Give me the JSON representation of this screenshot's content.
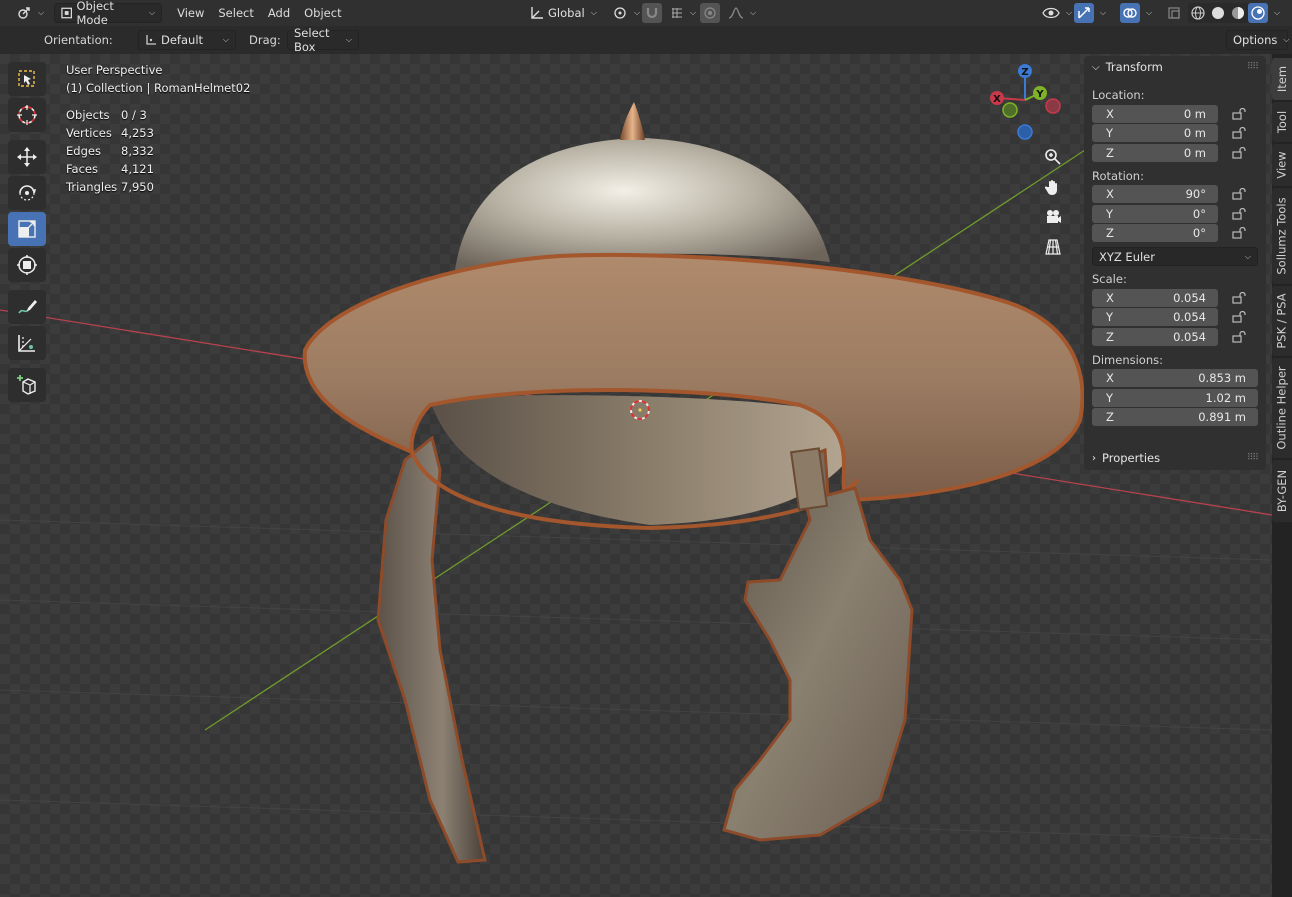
{
  "header": {
    "editor_type_icon": "3d-viewport-icon",
    "mode_label": "Object Mode",
    "menus": [
      "View",
      "Select",
      "Add",
      "Object"
    ],
    "transform_orientation": "Global",
    "options_label": "Options"
  },
  "tool_settings": {
    "orientation_label": "Orientation:",
    "orientation_value": "Default",
    "drag_label": "Drag:",
    "drag_value": "Select Box"
  },
  "viewport": {
    "view_name": "User Perspective",
    "collection_line": "(1) Collection | RomanHelmet02",
    "stats": [
      {
        "label": "Objects",
        "value": "0 / 3"
      },
      {
        "label": "Vertices",
        "value": "4,253"
      },
      {
        "label": "Edges",
        "value": "8,332"
      },
      {
        "label": "Faces",
        "value": "4,121"
      },
      {
        "label": "Triangles",
        "value": "7,950"
      }
    ],
    "gizmo": {
      "x": "X",
      "y": "Y",
      "z": "Z"
    }
  },
  "toolbar": {
    "tools": [
      "select-box-icon",
      "cursor-icon",
      "move-icon",
      "rotate-icon",
      "scale-icon",
      "transform-icon",
      "annotate-icon",
      "measure-icon",
      "add-cube-icon"
    ],
    "active_tool": "scale-icon"
  },
  "npanel": {
    "transform_title": "Transform",
    "location_label": "Location:",
    "location": [
      {
        "axis": "X",
        "value": "0 m"
      },
      {
        "axis": "Y",
        "value": "0 m"
      },
      {
        "axis": "Z",
        "value": "0 m"
      }
    ],
    "rotation_label": "Rotation:",
    "rotation": [
      {
        "axis": "X",
        "value": "90°"
      },
      {
        "axis": "Y",
        "value": "0°"
      },
      {
        "axis": "Z",
        "value": "0°"
      }
    ],
    "rotation_mode": "XYZ Euler",
    "scale_label": "Scale:",
    "scale": [
      {
        "axis": "X",
        "value": "0.054"
      },
      {
        "axis": "Y",
        "value": "0.054"
      },
      {
        "axis": "Z",
        "value": "0.054"
      }
    ],
    "dimensions_label": "Dimensions:",
    "dimensions": [
      {
        "axis": "X",
        "value": "0.853 m"
      },
      {
        "axis": "Y",
        "value": "1.02 m"
      },
      {
        "axis": "Z",
        "value": "0.891 m"
      }
    ],
    "properties_title": "Properties"
  },
  "sidetabs": [
    "Item",
    "Tool",
    "View",
    "Sollumz Tools",
    "PSK / PSA",
    "Outline Helper",
    "BY-GEN"
  ],
  "colors": {
    "accent": "#4772b3",
    "x_axis": "#c8394a",
    "y_axis": "#7fb327",
    "z_axis": "#3a7bd5"
  }
}
